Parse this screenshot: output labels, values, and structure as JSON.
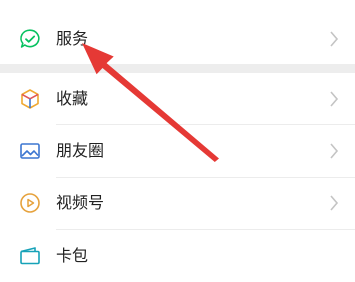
{
  "menu": {
    "items": [
      {
        "label": "服务",
        "icon": "service-check-icon",
        "color": "#07c160"
      },
      {
        "label": "收藏",
        "icon": "cube-icon",
        "color": "#f0a830"
      },
      {
        "label": "朋友圈",
        "icon": "landscape-photo-icon",
        "color": "#3c76d1"
      },
      {
        "label": "视频号",
        "icon": "play-circle-icon",
        "color": "#e6a23c"
      },
      {
        "label": "卡包",
        "icon": "card-wallet-icon",
        "color": "#17a2b8"
      }
    ]
  },
  "annotation": {
    "arrow_color": "#e53935",
    "target": "服务"
  }
}
